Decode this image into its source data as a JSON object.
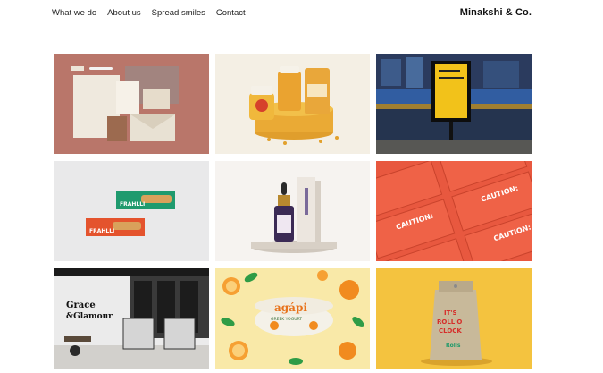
{
  "nav": {
    "items": [
      {
        "label": "What we do"
      },
      {
        "label": "About us"
      },
      {
        "label": "Spread smiles"
      },
      {
        "label": "Contact"
      }
    ]
  },
  "brand": {
    "name": "Minakshi & Co."
  },
  "portfolio": {
    "tiles": [
      {
        "subject": "stationery-mockup",
        "colors": [
          "#b9766a",
          "#e8e2d6",
          "#8a5a44"
        ]
      },
      {
        "subject": "supplement-packaging",
        "colors": [
          "#f4efe4",
          "#e9a832",
          "#f3bd3b"
        ]
      },
      {
        "subject": "bus-stop-billboard",
        "colors": [
          "#1d2a44",
          "#f2c21a",
          "#3a74c9"
        ]
      },
      {
        "subject": "snack-bar-wrappers",
        "colors": [
          "#e9e9ea",
          "#1f9a6e",
          "#e4532d"
        ]
      },
      {
        "subject": "dropper-bottle-box",
        "colors": [
          "#f6f3f0",
          "#3b2a55",
          "#e9e2dc"
        ]
      },
      {
        "subject": "caution-boxes",
        "colors": [
          "#e8583f",
          "#ffffff",
          "#c9432c"
        ]
      },
      {
        "subject": "salon-interior",
        "colors": [
          "#ebebeb",
          "#1a1a1a",
          "#6b6b6b"
        ]
      },
      {
        "subject": "yogurt-with-oranges",
        "colors": [
          "#f9e9a8",
          "#f18b1f",
          "#2f9c46"
        ]
      },
      {
        "subject": "paper-bag",
        "colors": [
          "#f4c33f",
          "#b9a98a",
          "#d62e2a"
        ]
      }
    ],
    "texts": {
      "grace": "Grace",
      "glamour": "&Glamour",
      "frahlli": "FRAHLLI",
      "caution": "CAUTION:",
      "agapi": "agápi",
      "greek_yogurt": "GREEK YOGURT",
      "its": "IT'S",
      "rollo": "ROLL'O",
      "clock": "CLOCK",
      "rolls": "Rolls"
    }
  }
}
